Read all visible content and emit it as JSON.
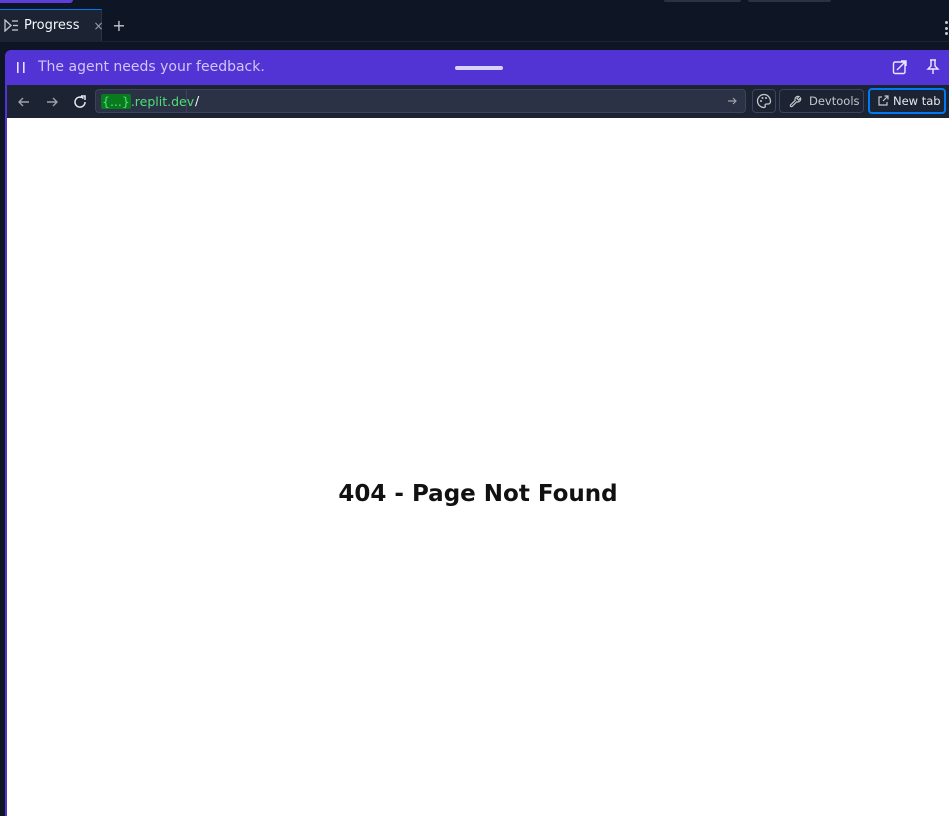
{
  "tabbar": {
    "active_tab": {
      "label": "Progress",
      "icon": "progress-icon",
      "close": "×"
    },
    "new_tab_symbol": "+"
  },
  "feedback_bar": {
    "message": "The agent needs your feedback.",
    "background": "#5233d4"
  },
  "browser": {
    "url": {
      "domain_highlight": "{...}",
      "domain_rest": ".replit.dev",
      "path": "/"
    },
    "devtools_label": "Devtools",
    "new_tab_label": "New tab"
  },
  "page": {
    "heading": "404 - Page Not Found"
  },
  "colors": {
    "accent": "#0079f2",
    "url_green": "#4ee077",
    "toolbar_bg": "#1c2333"
  }
}
